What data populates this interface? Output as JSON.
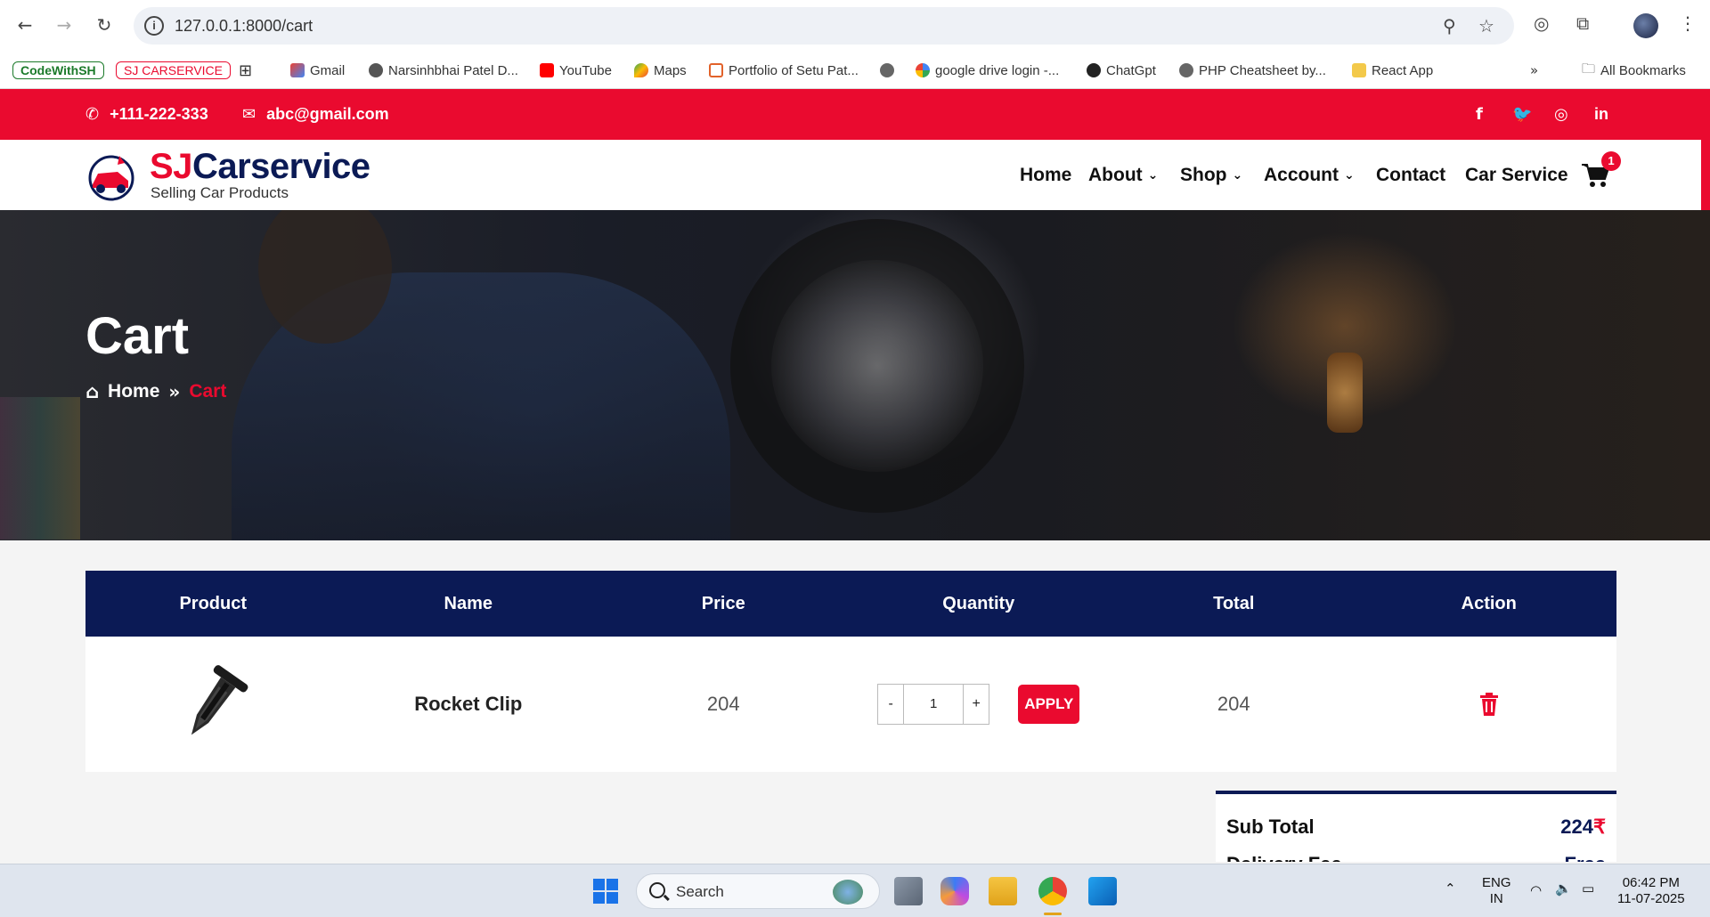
{
  "browser": {
    "url": "127.0.0.1:8000/cart",
    "bookmarks": [
      "CodeWithSH",
      "SJ CARSERVICE",
      "Gmail",
      "Narsinhbhai Patel D...",
      "YouTube",
      "Maps",
      "Portfolio of Setu Pat...",
      "google drive login -...",
      "ChatGpt",
      "PHP Cheatsheet by...",
      "React App"
    ],
    "all_bookmarks": "All Bookmarks"
  },
  "topbar": {
    "phone": "+111-222-333",
    "email": "abc@gmail.com",
    "social": [
      "facebook-icon",
      "twitter-icon",
      "instagram-icon",
      "linkedin-icon"
    ]
  },
  "brand": {
    "name_accent": "SJ",
    "name_rest": "Carservice",
    "tagline": "Selling Car Products"
  },
  "nav": {
    "home": "Home",
    "about": "About",
    "shop": "Shop",
    "account": "Account",
    "contact": "Contact",
    "car_service": "Car Service",
    "cart_count": "1"
  },
  "hero": {
    "title": "Cart",
    "breadcrumb_home": "Home",
    "breadcrumb_current": "Cart"
  },
  "cart_table": {
    "headers": [
      "Product",
      "Name",
      "Price",
      "Quantity",
      "Total",
      "Action"
    ],
    "rows": [
      {
        "name": "Rocket Clip",
        "price": "204",
        "quantity": "1",
        "total": "204",
        "apply_label": "APPLY",
        "minus": "-",
        "plus": "+"
      }
    ]
  },
  "summary": {
    "subtotal_label": "Sub Total",
    "subtotal_value": "224",
    "currency": "₹",
    "delivery_label": "Delivery Fee",
    "delivery_value": "Free"
  },
  "taskbar": {
    "search_label": "Search",
    "lang_line1": "ENG",
    "lang_line2": "IN",
    "time": "06:42 PM",
    "date": "11-07-2025"
  },
  "colors": {
    "brand_red": "#ea0a2f",
    "brand_navy": "#0b1a55"
  }
}
